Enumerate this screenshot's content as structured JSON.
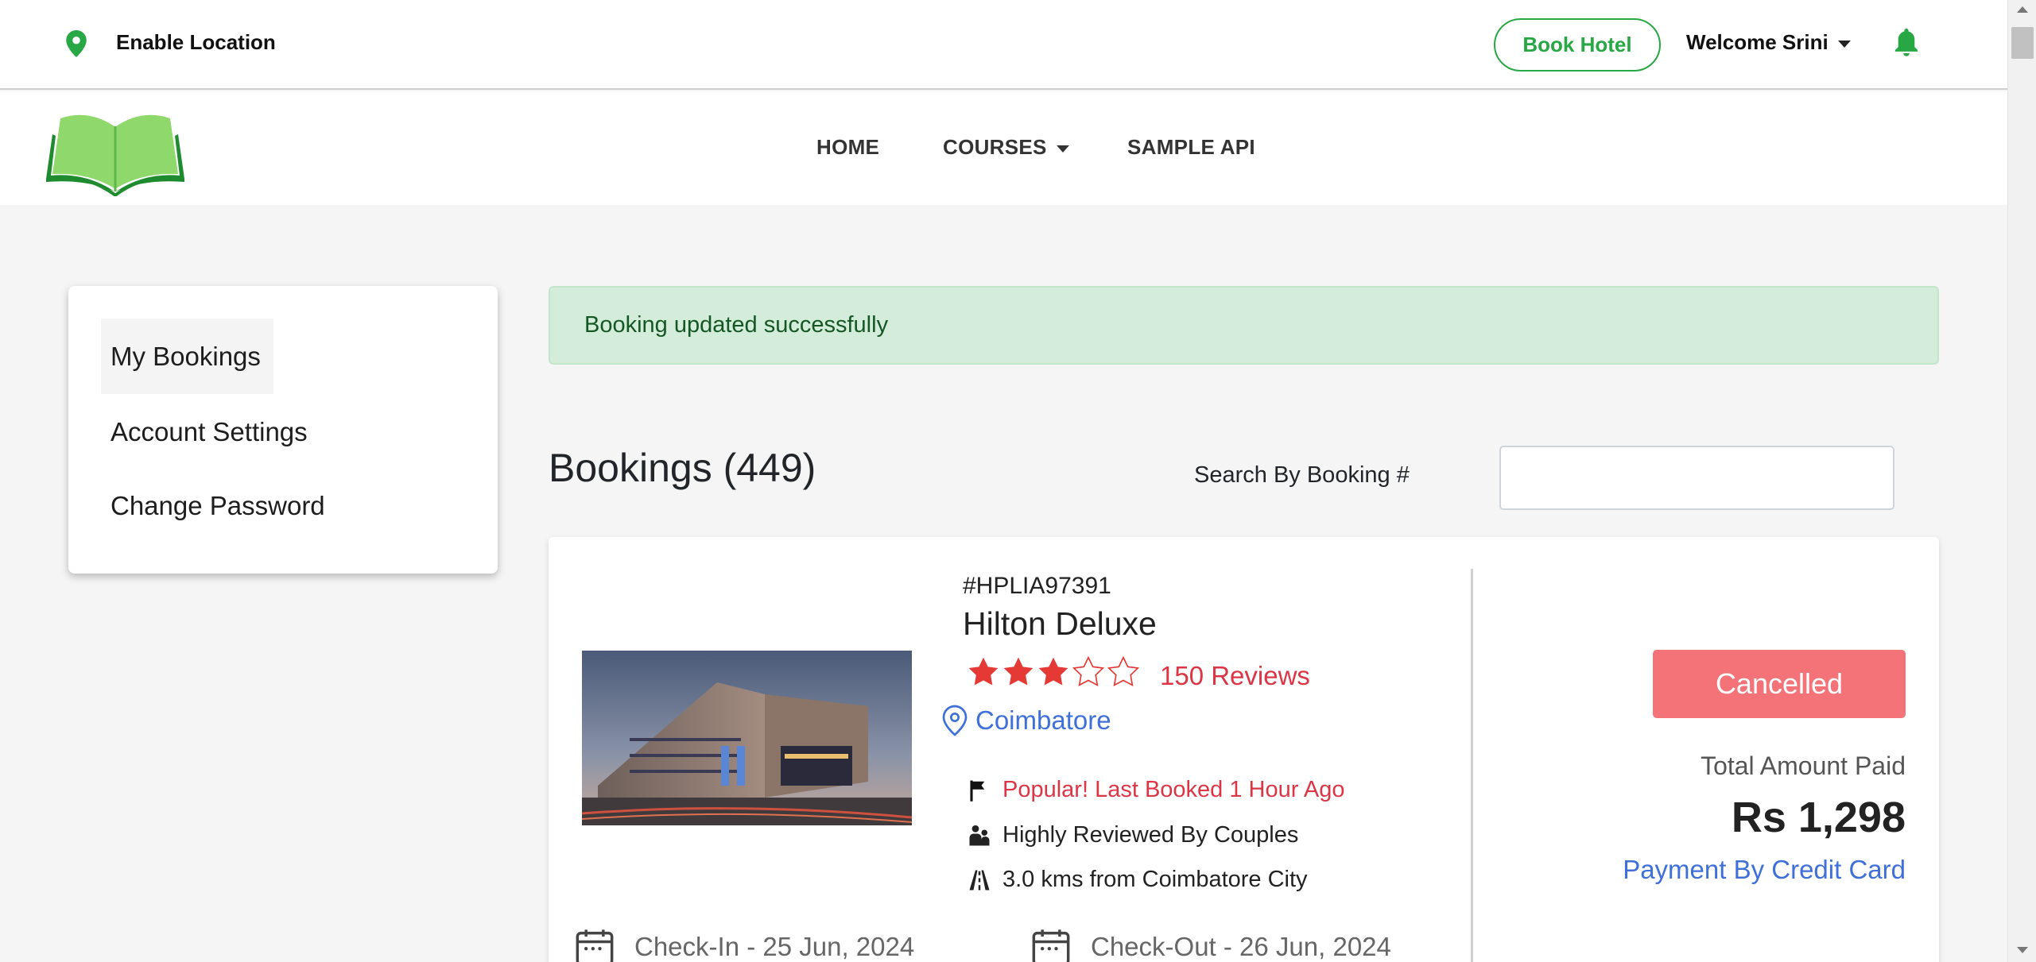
{
  "topbar": {
    "location_label": "Enable Location",
    "book_hotel_label": "Book Hotel",
    "welcome_label": "Welcome Srini"
  },
  "nav": {
    "items": [
      "HOME",
      "COURSES",
      "SAMPLE API"
    ]
  },
  "sidebar": {
    "items": [
      {
        "label": "My Bookings",
        "active": true
      },
      {
        "label": "Account Settings",
        "active": false
      },
      {
        "label": "Change Password",
        "active": false
      }
    ]
  },
  "alert": {
    "message": "Booking updated successfully"
  },
  "bookings": {
    "title": "Bookings (449)",
    "search_label": "Search By Booking #",
    "search_value": "",
    "search_placeholder": ""
  },
  "booking_card": {
    "booking_id": "#HPLIA97391",
    "hotel_name": "Hilton Deluxe",
    "rating": 3,
    "rating_max": 5,
    "reviews": "150 Reviews",
    "city": "Coimbatore",
    "features": [
      {
        "icon": "flag-icon",
        "text": "Popular! Last Booked 1 Hour Ago"
      },
      {
        "icon": "couple-icon",
        "text": "Highly Reviewed By Couples"
      },
      {
        "icon": "road-icon",
        "text": "3.0 kms from Coimbatore City"
      }
    ],
    "status": "Cancelled",
    "total_label": "Total Amount Paid",
    "total_value": "Rs 1,298",
    "payment_method": "Payment By Credit Card",
    "check_in": "Check-In - 25 Jun, 2024",
    "check_out": "Check-Out - 26 Jun, 2024"
  },
  "colors": {
    "brand_green": "#28a745",
    "alert_bg": "#d4edda",
    "alert_text": "#155724",
    "cancelled_bg": "#f47378",
    "review_red": "#dc3545",
    "link_blue": "#3f6fd8"
  }
}
